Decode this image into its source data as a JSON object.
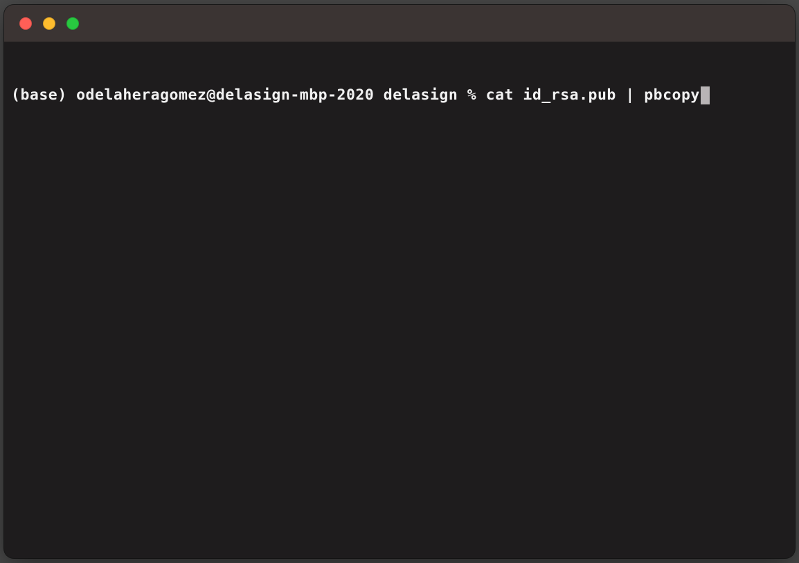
{
  "terminal": {
    "prompt": "(base) odelaheragomez@delasign-mbp-2020 delasign % ",
    "command": "cat id_rsa.pub | pbcopy"
  },
  "window_controls": {
    "close": "close",
    "minimize": "minimize",
    "maximize": "maximize"
  }
}
